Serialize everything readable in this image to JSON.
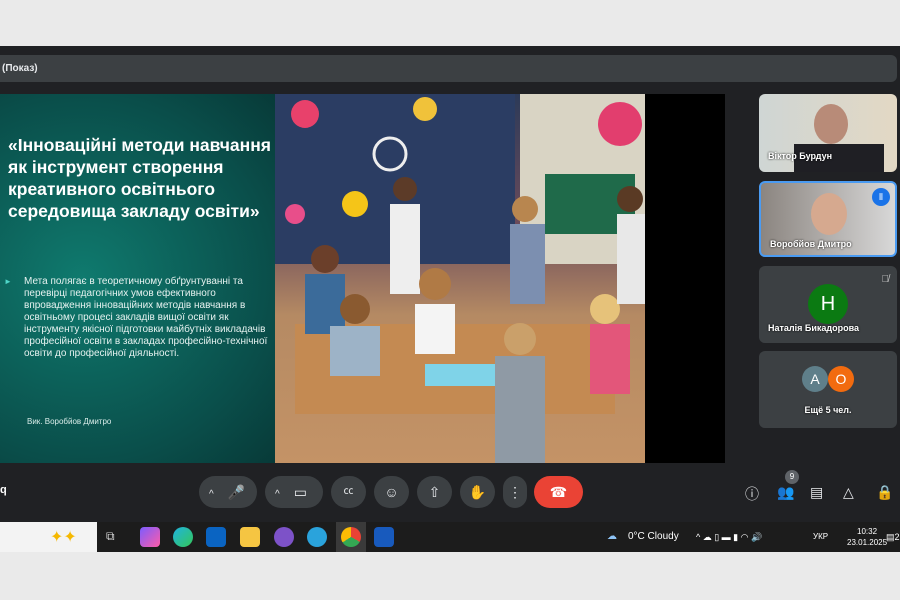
{
  "presentation_bar": {
    "label": "(Показ)"
  },
  "slide": {
    "title": "«Інноваційні методи навчання як інструмент створення креативного освітнього середовища закладу освіти»",
    "bullet": "Мета полягає в теоретичному обґрунтуванні та перевірці педагогічних умов ефективного впровадження інноваційних методів навчання в освітньому процесі закладів вищої освіти як інструменту якісної підготовки майбутніх викладачів професійної освіти в закладах професійно-технічної освіти до професійної діяльності.",
    "author": "Вик. Воробйов Дмитро"
  },
  "participants": [
    {
      "name": "Віктор Бурдун"
    },
    {
      "name": "Воробйов Дмитро",
      "speaking": true
    },
    {
      "name": "Наталія Бикадорова",
      "initial": "Н",
      "muted": true,
      "color": "#0b7a12"
    },
    {
      "name": "Ещё 5 чел.",
      "initials": [
        "А",
        "О"
      ],
      "colors": [
        "#5f7f8a",
        "#f26b0f"
      ]
    }
  ],
  "controls": {
    "left_letter": "q",
    "participants_count": "9"
  },
  "taskbar": {
    "weather": "0°C  Cloudy",
    "lang": "УКР",
    "time": "10:32",
    "date": "23.01.2025",
    "notif": "2"
  }
}
